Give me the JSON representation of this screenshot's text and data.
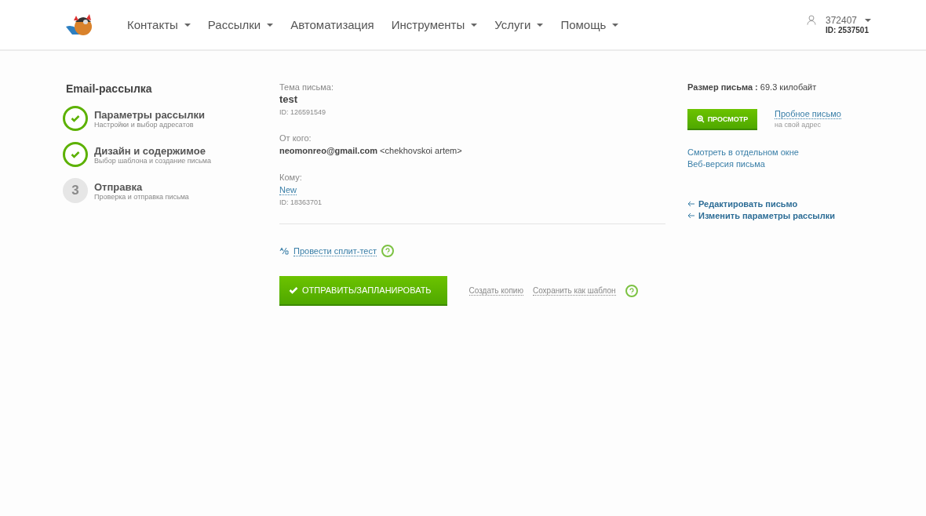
{
  "nav": [
    {
      "label": "Контакты",
      "dropdown": true
    },
    {
      "label": "Рассылки",
      "dropdown": true
    },
    {
      "label": "Автоматизация",
      "dropdown": false
    },
    {
      "label": "Инструменты",
      "dropdown": true
    },
    {
      "label": "Услуги",
      "dropdown": true
    },
    {
      "label": "Помощь",
      "dropdown": true
    }
  ],
  "account": {
    "login": "372407",
    "id": "ID: 2537501"
  },
  "sidebar": {
    "title": "Email-рассылка",
    "steps": [
      {
        "title": "Параметры рассылки",
        "subtitle": "Настройки и выбор адресатов",
        "done": true
      },
      {
        "title": "Дизайн и содержимое",
        "subtitle": "Выбор шаблона и создание письма",
        "done": true
      },
      {
        "number": "3",
        "title": "Отправка",
        "subtitle": "Проверка и отправка письма",
        "done": false
      }
    ]
  },
  "summary": {
    "subject_label": "Тема письма:",
    "subject": "test",
    "subject_id": "ID: 126591549",
    "from_label": "От кого:",
    "from": "**neomonreo@gmail.com** <chekhovskoi artem>",
    "to_label": "Кому:",
    "to": "New",
    "to_id": "ID: 18363701"
  },
  "split_test": "Провести сплит-тест",
  "send_button": "ОТПРАВИТЬ/ЗАПЛАНИРОВАТЬ",
  "secondary_links": [
    "Создать копию",
    "Сохранить как шаблон"
  ],
  "right": {
    "size": "**Размер письма :** 69.3 килобайт",
    "preview_button": "ПРОСМОТР",
    "test_link": "Пробное письмо",
    "test_hint": "на свой адрес",
    "view_links": [
      "Смотреть в отдельном окне",
      "Веб-версия письма"
    ],
    "back_links": [
      "Редактировать письмо",
      "Изменить параметры рассылки"
    ]
  }
}
